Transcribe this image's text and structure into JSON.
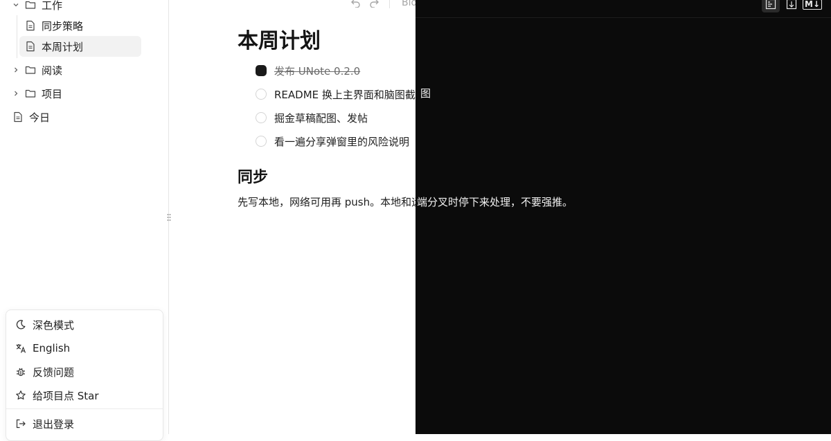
{
  "sidebar": {
    "tree": [
      {
        "label": "工作"
      },
      {
        "label": "同步策略"
      },
      {
        "label": "本周计划"
      },
      {
        "label": "阅读"
      },
      {
        "label": "项目"
      },
      {
        "label": "今日"
      }
    ],
    "menu": [
      {
        "label": "深色模式"
      },
      {
        "label": "English"
      },
      {
        "label": "反馈问题"
      },
      {
        "label": "给项目点 Star"
      },
      {
        "label": "退出登录"
      }
    ]
  },
  "toolbar": {
    "block_type_placeholder": "Block type"
  },
  "editor": {
    "title": "本周计划",
    "tasks": [
      {
        "label": "发布 UNote 0.2.0"
      },
      {
        "label": "README 换上主界面和脑图截图"
      },
      {
        "label": "掘金草稿配图、发帖"
      },
      {
        "label": "看一遍分享弹窗里的风险说明"
      }
    ],
    "section_title": "同步",
    "paragraph_part1": "先写本地，网络可用再 push。本地和远",
    "paragraph_part2": "端分叉时停下来处理，不要强推。",
    "task2_overflow": "图"
  },
  "dark_toolbar": {
    "md_label": "M↓"
  }
}
